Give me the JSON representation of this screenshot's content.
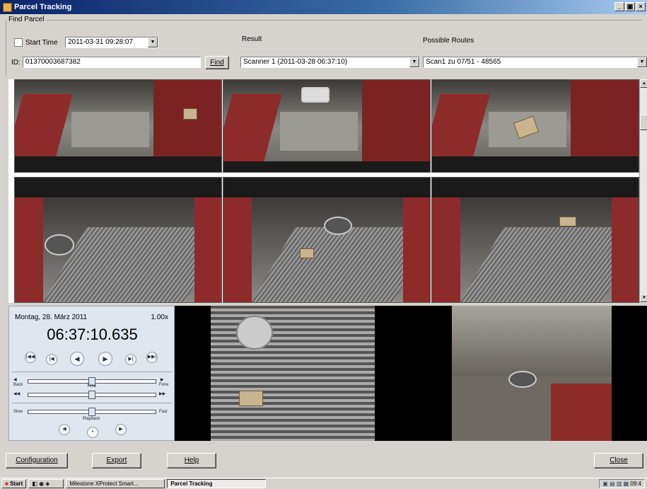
{
  "window": {
    "title": "Parcel Tracking",
    "minimize": "_",
    "maximize": "▣",
    "close": "×"
  },
  "find": {
    "group_label": "Find Parcel",
    "start_time_label": "Start Time",
    "start_time_checked": false,
    "start_time_value": "2011-03-31 09:28:07",
    "id_label": "ID:",
    "id_value": "01370003687382",
    "find_button": "Find",
    "result_label": "Result",
    "result_value": "Scanner 1 (2011-03-28 06:37:10)",
    "routes_label": "Possible Routes",
    "routes_value": "Scan1 zu 07/51 - 48565"
  },
  "playback": {
    "date": "Montag, 28. März 2011",
    "speed": "1.00x",
    "time": "06:37:10.635",
    "time_label": "Time",
    "playback_label": "Playback",
    "slow_label": "Slow",
    "fast_label": "Fast",
    "back_label": "Back",
    "fwd_label": "Forw"
  },
  "buttons": {
    "configuration": "Configuration",
    "export": "Export",
    "help": "Help",
    "close": "Close"
  },
  "taskbar": {
    "start": "Start",
    "items": [
      "Milestone XProtect Smart...",
      "Parcel Tracking"
    ],
    "clock": "09:4"
  }
}
